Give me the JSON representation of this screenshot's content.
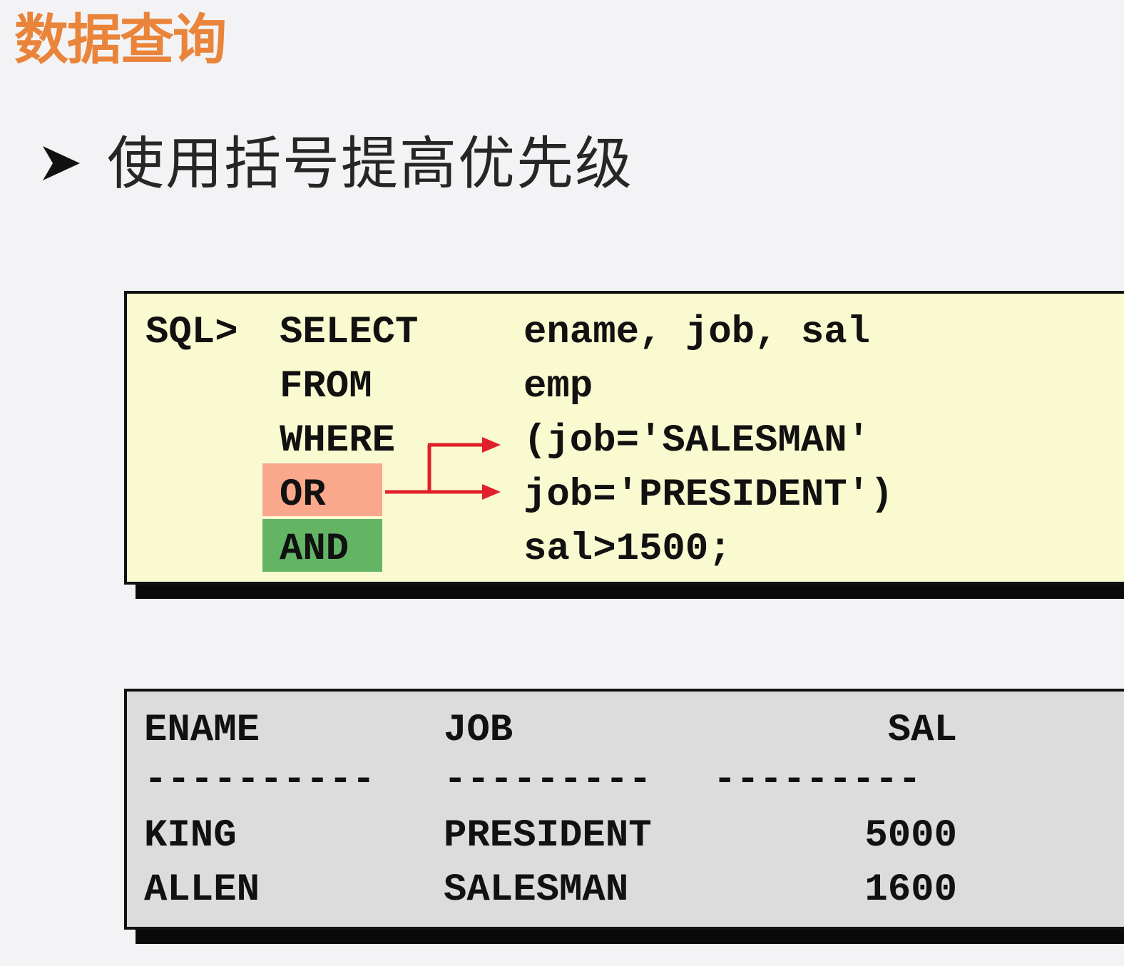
{
  "slide": {
    "title": "数据查询",
    "bullet": "使用括号提高优先级"
  },
  "colors": {
    "title": "#e9843a",
    "code_background": "#fafad1",
    "or_highlight": "#f9a88c",
    "and_highlight": "#63b564",
    "arrow": "#e0202a",
    "result_background": "#dcdcdc"
  },
  "icons": {
    "bullet": "arrowhead-bullet-icon",
    "connector": "bracket-arrow-icon"
  },
  "code": {
    "prompt": "SQL>",
    "lines": [
      {
        "keyword": "SELECT",
        "expr": "ename, job, sal"
      },
      {
        "keyword": "FROM",
        "expr": "emp"
      },
      {
        "keyword": "WHERE",
        "expr": "(job='SALESMAN'"
      },
      {
        "keyword": "OR",
        "expr": "job='PRESIDENT')"
      },
      {
        "keyword": "AND",
        "expr": "sal>1500;"
      }
    ]
  },
  "result": {
    "headers": [
      "ENAME",
      "JOB",
      "SAL"
    ],
    "separators": [
      "----------",
      "---------",
      "---------"
    ],
    "rows": [
      [
        "KING",
        "PRESIDENT",
        "5000"
      ],
      [
        "ALLEN",
        "SALESMAN",
        "1600"
      ]
    ]
  }
}
